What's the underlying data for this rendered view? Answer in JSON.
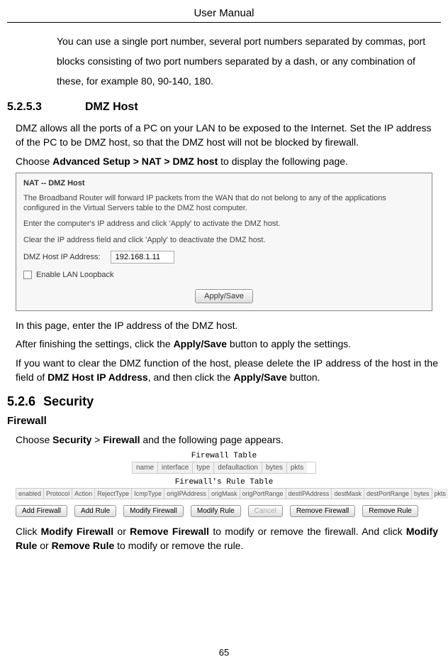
{
  "header": {
    "title": "User Manual"
  },
  "intro": {
    "text": "You can use a single port number, several port numbers separated by commas, port blocks consisting of two port numbers separated by a dash, or any combination of these, for example 80, 90-140, 180."
  },
  "s5253": {
    "num": "5.2.5.3",
    "title": "DMZ Host",
    "p1": "DMZ allows all the ports of a PC on your LAN to be exposed to the Internet. Set the IP address of the PC to be DMZ host, so that the DMZ host will not be blocked by firewall.",
    "p2_a": "Choose ",
    "p2_b": "Advanced Setup > NAT > DMZ host",
    "p2_c": " to display the following page.",
    "p3": "In this page, enter the IP address of the DMZ host.",
    "p4_a": "After finishing the settings, click the ",
    "p4_b": "Apply/Save",
    "p4_c": " button to apply the settings.",
    "p5_a": "If you want to clear the DMZ function of the host, please delete the IP address of the host in the field of ",
    "p5_b": "DMZ Host IP Address",
    "p5_c": ", and then click the ",
    "p5_d": "Apply/Save",
    "p5_e": " button."
  },
  "dmz_panel": {
    "title": "NAT -- DMZ Host",
    "line1": "The Broadband Router will forward IP packets from the WAN that do not belong to any of the applications configured in the Virtual Servers table to the DMZ host computer.",
    "line2": "Enter the computer's IP address and click 'Apply' to activate the DMZ host.",
    "line3": "Clear the IP address field and click 'Apply' to deactivate the DMZ host.",
    "ip_label": "DMZ Host IP Address:",
    "ip_value": "192.168.1.11",
    "loopback_label": "Enable LAN Loopback",
    "apply_btn": "Apply/Save"
  },
  "s526": {
    "num": "5.2.6",
    "title": "Security"
  },
  "firewall_sec": {
    "title": "Firewall",
    "p1_a": "Choose ",
    "p1_b": "Security",
    "p1_c": " > ",
    "p1_d": "Firewall",
    "p1_e": " and the following page appears.",
    "p2_a": "Click ",
    "p2_b": "Modify Firewall",
    "p2_c": " or ",
    "p2_d": "Remove Firewall",
    "p2_e": " to modify or remove the firewall. And click ",
    "p2_f": "Modify Rule",
    "p2_g": " or ",
    "p2_h": "Remove Rule",
    "p2_i": " to modify or remove the rule."
  },
  "fw_panel": {
    "table_title": "Firewall Table",
    "cols": [
      "name",
      "interface",
      "type",
      "defaultaction",
      "bytes",
      "pkts"
    ],
    "rule_title": "Firewall's Rule Table",
    "rule_cols": [
      "enabled",
      "Protocol",
      "Action",
      "RejectType",
      "IcmpType",
      "origIPAddress",
      "origMask",
      "origPortRange",
      "destIPAddress",
      "destMask",
      "destPortRange",
      "bytes",
      "pkts"
    ],
    "btns": {
      "add_fw": "Add Firewall",
      "add_rule": "Add Rule",
      "modify_fw": "Modify Firewall",
      "modify_rule": "Modify Rule",
      "cancel": "Cancel",
      "remove_fw": "Remove Firewall",
      "remove_rule": "Remove Rule"
    }
  },
  "page_number": "65"
}
